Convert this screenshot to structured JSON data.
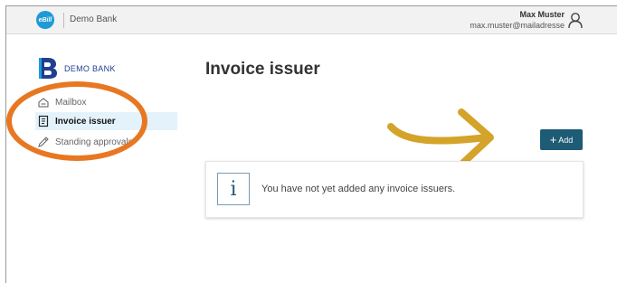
{
  "header": {
    "ebill_logo_text": "eBill",
    "bank_name": "Demo Bank",
    "user_name": "Max Muster",
    "user_email": "max.muster@mailadresse"
  },
  "sidebar": {
    "brand": "DEMO BANK",
    "items": [
      {
        "label": "Mailbox",
        "icon": "mailbox-icon"
      },
      {
        "label": "Invoice issuer",
        "icon": "document-icon",
        "active": true
      },
      {
        "label": "Standing approvals",
        "icon": "pen-icon"
      }
    ]
  },
  "main": {
    "title": "Invoice issuer",
    "add_button_label": "Add",
    "info_icon_glyph": "i",
    "empty_message": "You have not yet added any invoice issuers."
  },
  "colors": {
    "accent": "#1e5b75",
    "ebill": "#1e9ad6",
    "active_bg": "#e4f3fb",
    "annotation_oval": "#e87722",
    "annotation_arrow": "#d4a329"
  }
}
